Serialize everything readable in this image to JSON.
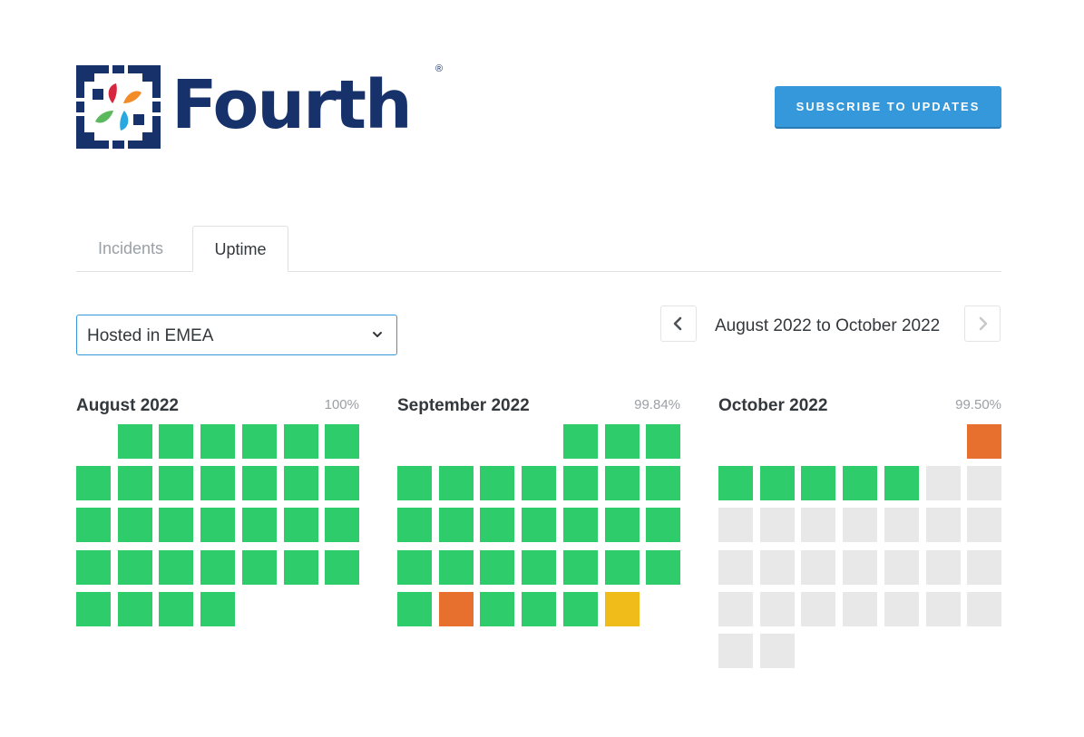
{
  "brand": {
    "name": "Fourth",
    "registered": "®"
  },
  "header": {
    "subscribe_label": "SUBSCRIBE TO UPDATES"
  },
  "tabs": [
    {
      "label": "Incidents",
      "active": false
    },
    {
      "label": "Uptime",
      "active": true
    }
  ],
  "component_select": {
    "value": "Hosted in EMEA"
  },
  "range": {
    "label": "August 2022 to October 2022"
  },
  "status_colors": {
    "operational": "#2ecc6a",
    "major": "#e8702f",
    "minor": "#f0bc19",
    "no_data": "#e8e8e8",
    "accent": "#3498db",
    "brand": "#17316a"
  },
  "months": [
    {
      "name": "August 2022",
      "uptime": "100%",
      "first_weekday": 1,
      "days": [
        "op",
        "op",
        "op",
        "op",
        "op",
        "op",
        "op",
        "op",
        "op",
        "op",
        "op",
        "op",
        "op",
        "op",
        "op",
        "op",
        "op",
        "op",
        "op",
        "op",
        "op",
        "op",
        "op",
        "op",
        "op",
        "op",
        "op",
        "op",
        "op",
        "op",
        "op"
      ]
    },
    {
      "name": "September 2022",
      "uptime": "99.84%",
      "first_weekday": 4,
      "days": [
        "op",
        "op",
        "op",
        "op",
        "op",
        "op",
        "op",
        "op",
        "op",
        "op",
        "op",
        "op",
        "op",
        "op",
        "op",
        "op",
        "op",
        "op",
        "op",
        "op",
        "op",
        "op",
        "op",
        "op",
        "op",
        "major",
        "op",
        "op",
        "op",
        "minor"
      ]
    },
    {
      "name": "October 2022",
      "uptime": "99.50%",
      "first_weekday": 6,
      "days": [
        "major",
        "op",
        "op",
        "op",
        "op",
        "op",
        "none",
        "none",
        "none",
        "none",
        "none",
        "none",
        "none",
        "none",
        "none",
        "none",
        "none",
        "none",
        "none",
        "none",
        "none",
        "none",
        "none",
        "none",
        "none",
        "none",
        "none",
        "none",
        "none",
        "none",
        "none"
      ]
    }
  ]
}
